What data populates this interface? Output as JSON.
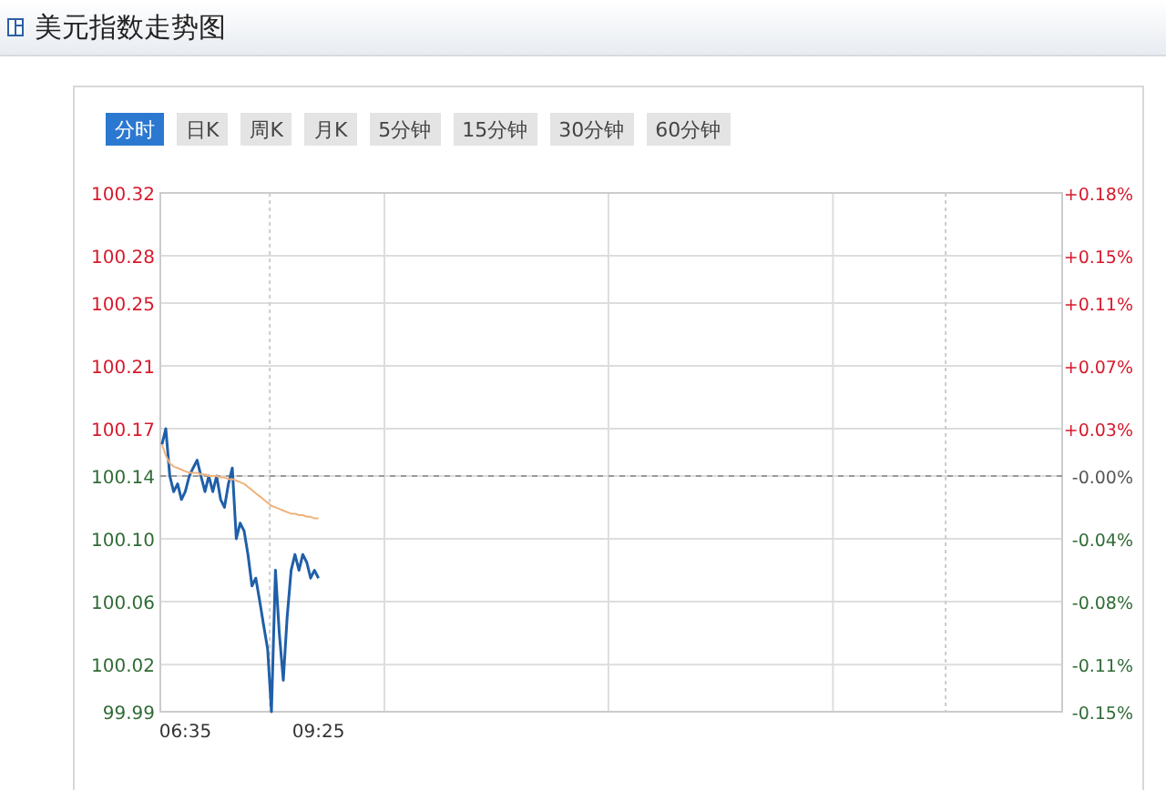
{
  "title": "美元指数走势图",
  "tabs": [
    {
      "label": "分时",
      "selected": true
    },
    {
      "label": "日K",
      "selected": false
    },
    {
      "label": "周K",
      "selected": false
    },
    {
      "label": "月K",
      "selected": false
    },
    {
      "label": "5分钟",
      "selected": false
    },
    {
      "label": "15分钟",
      "selected": false
    },
    {
      "label": "30分钟",
      "selected": false
    },
    {
      "label": "60分钟",
      "selected": false
    }
  ],
  "chart": {
    "percent_ticks": [
      {
        "label": "+0.18%",
        "kind": "up"
      },
      {
        "label": "+0.15%",
        "kind": "up"
      },
      {
        "label": "+0.11%",
        "kind": "up"
      },
      {
        "label": "+0.07%",
        "kind": "up"
      },
      {
        "label": "+0.03%",
        "kind": "up"
      },
      {
        "label": "-0.00%",
        "kind": "flat"
      },
      {
        "label": "-0.04%",
        "kind": "down"
      },
      {
        "label": "-0.08%",
        "kind": "down"
      },
      {
        "label": "-0.11%",
        "kind": "down"
      },
      {
        "label": "-0.15%",
        "kind": "down"
      }
    ],
    "chart_data": {
      "type": "line",
      "ylim": [
        99.99,
        100.32
      ],
      "grid": true,
      "xlim": [
        6.05,
        25.25
      ],
      "xticks": [
        {
          "value": 6.5833,
          "label": "06:35"
        },
        {
          "value": 9.4167,
          "label": "09:25"
        }
      ],
      "x": [
        6.0833,
        6.1667,
        6.25,
        6.3333,
        6.4167,
        6.5,
        6.5833,
        6.6667,
        6.75,
        6.8333,
        6.9167,
        7,
        7.0833,
        7.1667,
        7.25,
        7.3333,
        7.4167,
        7.5,
        7.5833,
        7.6667,
        7.75,
        7.8333,
        7.9167,
        8,
        8.0833,
        8.1667,
        8.25,
        8.3333,
        8.4167,
        8.5,
        8.5833,
        8.6667,
        8.75,
        8.8333,
        8.9167,
        9,
        9.0833,
        9.1667,
        9.25,
        9.3333,
        9.4167
      ],
      "ref_lines": [
        {
          "axis": "y",
          "value": 100.14
        },
        {
          "axis": "x",
          "value": 8.38
        },
        {
          "axis": "x",
          "value": 22.77
        }
      ],
      "yticks": [
        {
          "value": 100.32,
          "label": "100.32"
        },
        {
          "value": 100.28,
          "label": "100.28"
        },
        {
          "value": 100.25,
          "label": "100.25"
        },
        {
          "value": 100.21,
          "label": "100.21"
        },
        {
          "value": 100.17,
          "label": "100.17"
        },
        {
          "value": 100.14,
          "label": "100.14"
        },
        {
          "value": 100.1,
          "label": "100.10"
        },
        {
          "value": 100.06,
          "label": "100.06"
        },
        {
          "value": 100.02,
          "label": "100.02"
        },
        {
          "value": 99.99,
          "label": "99.99"
        }
      ],
      "series": [
        {
          "color": "#1f5fa8",
          "values": [
            100.16,
            100.17,
            100.14,
            100.13,
            100.135,
            100.125,
            100.13,
            100.14,
            100.145,
            100.15,
            100.14,
            100.13,
            100.14,
            100.13,
            100.14,
            100.125,
            100.12,
            100.135,
            100.145,
            100.1,
            100.11,
            100.105,
            100.09,
            100.07,
            100.075,
            100.06,
            100.045,
            100.03,
            99.99,
            100.08,
            100.04,
            100.01,
            100.05,
            100.08,
            100.09,
            100.08,
            100.09,
            100.085,
            100.075,
            100.08,
            100.075
          ]
        },
        {
          "color": "#f0b27a",
          "values": [
            100.16,
            100.153,
            100.148,
            100.146,
            100.145,
            100.144,
            100.143,
            100.142,
            100.142,
            100.142,
            100.141,
            100.141,
            100.14,
            100.14,
            100.14,
            100.139,
            100.139,
            100.138,
            100.138,
            100.137,
            100.136,
            100.135,
            100.133,
            100.131,
            100.129,
            100.127,
            100.125,
            100.123,
            100.121,
            100.12,
            100.119,
            100.118,
            100.117,
            100.116,
            100.116,
            100.115,
            100.115,
            100.114,
            100.114,
            100.113,
            100.113
          ]
        }
      ]
    }
  }
}
